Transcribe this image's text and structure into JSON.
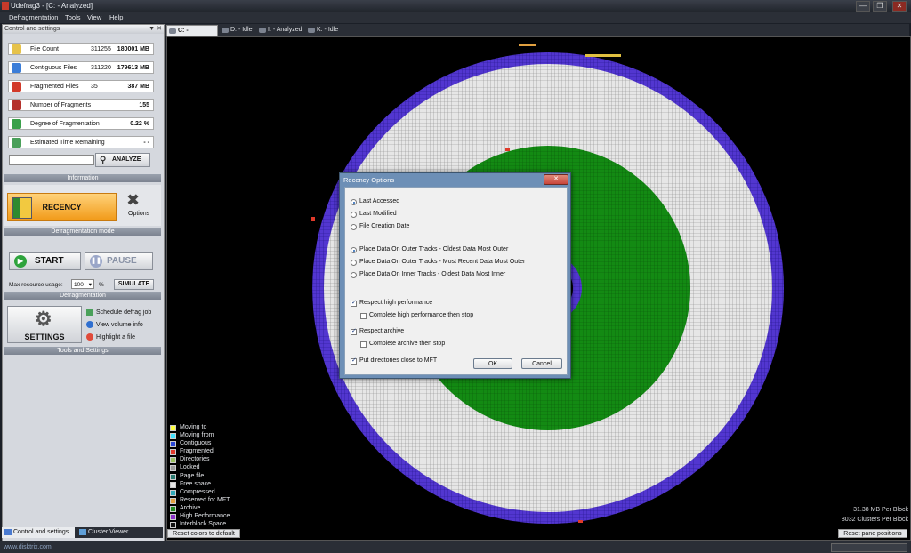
{
  "window": {
    "title": "Udefrag3 - [C: - Analyzed]",
    "controls": [
      "—",
      "❐",
      "✕"
    ]
  },
  "menu": [
    "Defragmentation",
    "Tools",
    "View",
    "Help"
  ],
  "left_panel": {
    "header": "Control and settings",
    "header_icons": [
      "▼",
      "✕"
    ],
    "stats": [
      {
        "label": "File Count",
        "value1": "311255",
        "value2": "180001 MB",
        "color": "#e6c24a"
      },
      {
        "label": "Contiguous Files",
        "value1": "311220",
        "value2": "179613 MB",
        "color": "#3b7dd8"
      },
      {
        "label": "Fragmented Files",
        "value1": "35",
        "value2": "387 MB",
        "color": "#d23a2a"
      },
      {
        "label": "Number of Fragments",
        "value1": "",
        "value2": "155",
        "color": "#b5312b"
      },
      {
        "label": "Degree of Fragmentation",
        "value1": "",
        "value2": "0.22 %",
        "color": "#3aa04a"
      },
      {
        "label": "Estimated Time Remaining",
        "value1": "",
        "value2": "- -",
        "color": "#4aa05a"
      }
    ],
    "analyze_input": "",
    "analyze_label": "ANALYZE",
    "info_label": "Information",
    "mode": {
      "recency_label": "RECENCY",
      "options_label": "Options",
      "section_label": "Defragmentation mode"
    },
    "defrag": {
      "start_label": "START",
      "pause_label": "PAUSE",
      "resource_label": "Max resource usage:",
      "resource_value": "100",
      "resource_unit": "%",
      "simulate_label": "SIMULATE",
      "section_label": "Defragmentation"
    },
    "tools": {
      "settings_label": "SETTINGS",
      "links": [
        "Schedule defrag job",
        "View volume info",
        "Highlight a file"
      ],
      "section_label": "Tools and Settings"
    },
    "bottom_tabs": [
      "Control and settings",
      "Cluster Viewer"
    ]
  },
  "volume_tabs": [
    {
      "label": "C: - Analyzed",
      "active": true
    },
    {
      "label": "D: - Idle",
      "active": false
    },
    {
      "label": "I: - Analyzed",
      "active": false
    },
    {
      "label": "K: - Idle",
      "active": false
    }
  ],
  "legend": [
    {
      "label": "Moving to",
      "color": "#ffff40"
    },
    {
      "label": "Moving from",
      "color": "#40e0ff"
    },
    {
      "label": "Contiguous",
      "color": "#2a48d8"
    },
    {
      "label": "Fragmented",
      "color": "#e03a2a"
    },
    {
      "label": "Directories",
      "color": "#9ac060"
    },
    {
      "label": "Locked",
      "color": "#9a9a9a"
    },
    {
      "label": "Page file",
      "color": "#2a7a70"
    },
    {
      "label": "Free space",
      "color": "#e8e8e8"
    },
    {
      "label": "Compressed",
      "color": "#30a8b8"
    },
    {
      "label": "Reserved for MFT",
      "color": "#e0a040"
    },
    {
      "label": "Archive",
      "color": "#1e8a1e"
    },
    {
      "label": "High Performance",
      "color": "#8a30c8"
    },
    {
      "label": "Interblock Space",
      "color": "#111111"
    }
  ],
  "map": {
    "reset_colors_label": "Reset colors to default",
    "reset_pane_label": "Reset pane positions",
    "mb_per_block": "31.38 MB Per Block",
    "clusters_per_block": "8032 Clusters Per Block",
    "colors": {
      "outer": "#4a30c0",
      "free": "#e4e4e4",
      "archive": "#138a13",
      "frag": "#e03a2a"
    }
  },
  "dialog": {
    "title": "Recency Options",
    "close": "✕",
    "radios_date": [
      {
        "label": "Last Accessed",
        "checked": true
      },
      {
        "label": "Last Modified",
        "checked": false
      },
      {
        "label": "File Creation Date",
        "checked": false
      }
    ],
    "radios_place": [
      {
        "label": "Place Data On Outer Tracks - Oldest Data Most Outer",
        "checked": true
      },
      {
        "label": "Place Data On Outer Tracks - Most Recent Data Most Outer",
        "checked": false
      },
      {
        "label": "Place Data On Inner Tracks - Oldest Data Most Inner",
        "checked": false
      }
    ],
    "checks": [
      {
        "label": "Respect high performance",
        "checked": true,
        "indent": false
      },
      {
        "label": "Complete high performance then stop",
        "checked": false,
        "indent": true
      },
      {
        "label": "Respect archive",
        "checked": true,
        "indent": false
      },
      {
        "label": "Complete archive then stop",
        "checked": false,
        "indent": true
      },
      {
        "label": "Put directories close to MFT",
        "checked": true,
        "indent": false
      }
    ],
    "ok_label": "OK",
    "cancel_label": "Cancel"
  },
  "status": {
    "url": "www.disktrix.com"
  }
}
